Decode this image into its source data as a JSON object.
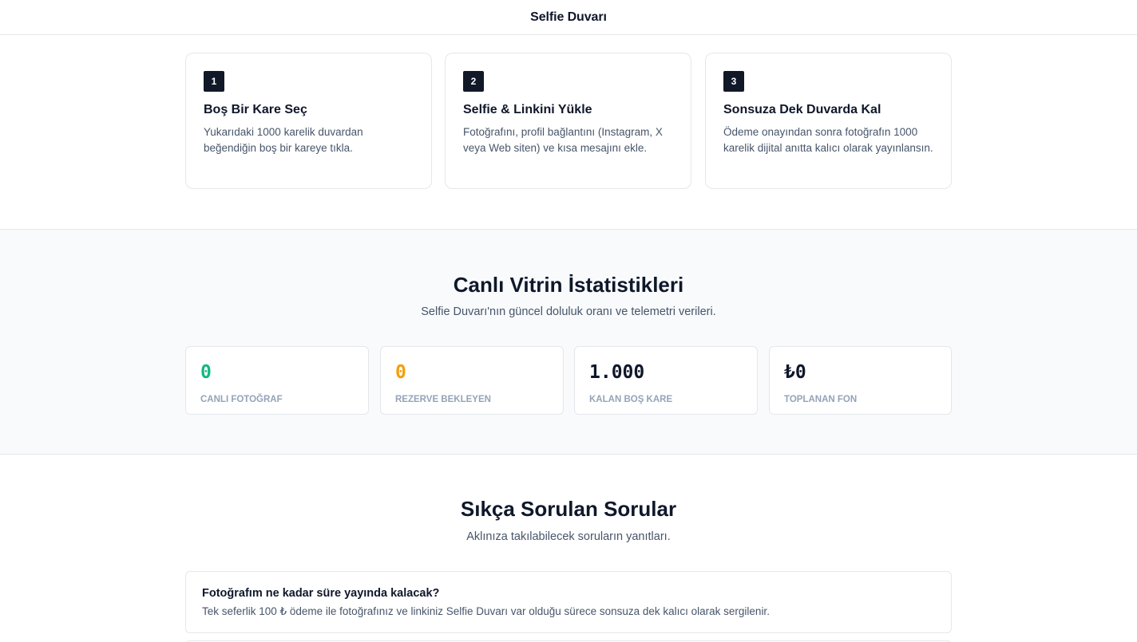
{
  "header": {
    "title": "Selfie Duvarı"
  },
  "steps": [
    {
      "number": "1",
      "title": "Boş Bir Kare Seç",
      "text": "Yukarıdaki 1000 karelik duvardan beğendiğin boş bir kareye tıkla."
    },
    {
      "number": "2",
      "title": "Selfie & Linkini Yükle",
      "text": "Fotoğrafını, profil bağlantını (Instagram, X veya Web siten) ve kısa mesajını ekle."
    },
    {
      "number": "3",
      "title": "Sonsuza Dek Duvarda Kal",
      "text": "Ödeme onayından sonra fotoğrafın 1000 karelik dijital anıtta kalıcı olarak yayınlansın."
    }
  ],
  "stats": {
    "title": "Canlı Vitrin İstatistikleri",
    "subtitle": "Selfie Duvarı'nın güncel doluluk oranı ve telemetri verileri.",
    "cards": [
      {
        "value": "0",
        "label": "CANLI FOTOĞRAF",
        "color": "#10b981"
      },
      {
        "value": "0",
        "label": "REZERVE BEKLEYEN",
        "color": "#f59e0b"
      },
      {
        "value": "1.000",
        "label": "KALAN BOŞ KARE",
        "color": "#0f172a"
      },
      {
        "value": "₺0",
        "label": "TOPLANAN FON",
        "color": "#0f172a"
      }
    ]
  },
  "faq": {
    "title": "Sıkça Sorulan Sorular",
    "subtitle": "Aklınıza takılabilecek soruların yanıtları.",
    "items": [
      {
        "question": "Fotoğrafım ne kadar süre yayında kalacak?",
        "answer": "Tek seferlik 100 ₺ ödeme ile fotoğrafınız ve linkiniz Selfie Duvarı var olduğu sürece sonsuza dek kalıcı olarak sergilenir."
      }
    ]
  }
}
